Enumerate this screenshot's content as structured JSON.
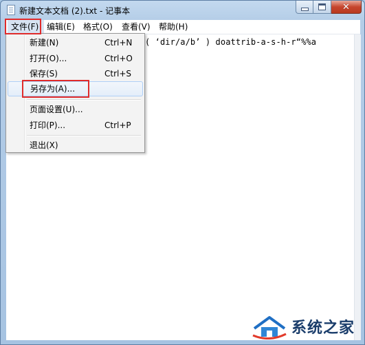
{
  "window": {
    "title": "新建文本文档 (2).txt - 记事本",
    "buttons": {
      "minimize_icon": "minimize-icon",
      "maximize_icon": "maximize-icon",
      "close_glyph": "✕"
    }
  },
  "menubar": {
    "items": [
      {
        "label": "文件(F)"
      },
      {
        "label": "编辑(E)"
      },
      {
        "label": "格式(O)"
      },
      {
        "label": "查看(V)"
      },
      {
        "label": "帮助(H)"
      }
    ],
    "active_index": 0
  },
  "file_menu": {
    "items": [
      {
        "label": "新建(N)",
        "shortcut": "Ctrl+N"
      },
      {
        "label": "打开(O)...",
        "shortcut": "Ctrl+O"
      },
      {
        "label": "保存(S)",
        "shortcut": "Ctrl+S"
      },
      {
        "label": "另存为(A)...",
        "shortcut": ""
      },
      {
        "label": "页面设置(U)...",
        "shortcut": ""
      },
      {
        "label": "打印(P)...",
        "shortcut": "Ctrl+P"
      },
      {
        "label": "退出(X)",
        "shortcut": ""
      }
    ],
    "highlighted_item": "另存为(A)..."
  },
  "editor": {
    "content": "( ‘dir/a/b’ ) doattrib-a-s-h-r“%%a"
  },
  "watermark": {
    "text": "系统之家"
  },
  "colors": {
    "highlight_box": "#e02b2b",
    "titlebar": "#b4cde7",
    "close_button": "#c6452e"
  }
}
